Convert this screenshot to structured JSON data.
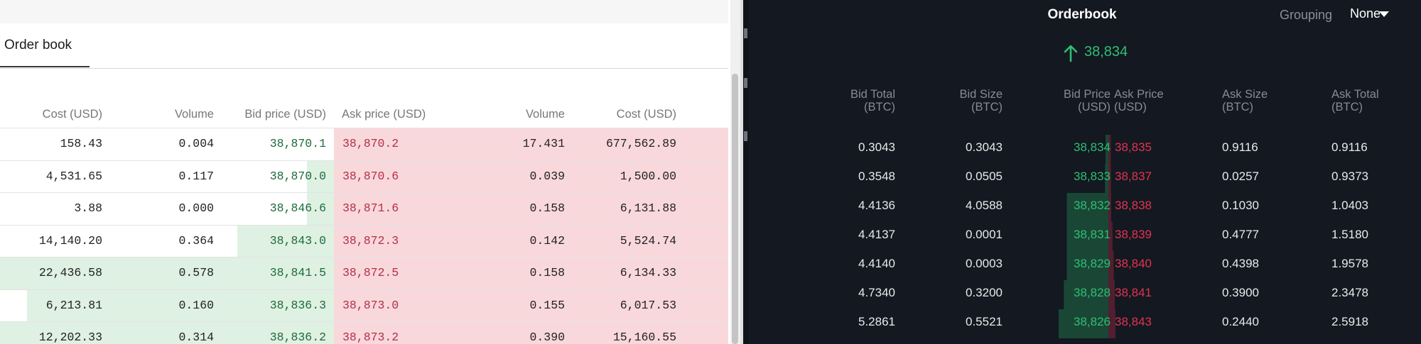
{
  "left": {
    "tab_label": "Order book",
    "headers": [
      "Cost (USD)",
      "Volume",
      "Bid price (USD)",
      "Ask price (USD)",
      "Volume",
      "Cost (USD)"
    ],
    "rows": [
      {
        "bid_cost": "158.43",
        "bid_vol": "0.004",
        "bid_price": "38,870.1",
        "ask_price": "38,870.2",
        "ask_vol": "17.431",
        "ask_cost": "677,562.89",
        "bid_depth": 0.0
      },
      {
        "bid_cost": "4,531.65",
        "bid_vol": "0.117",
        "bid_price": "38,870.0",
        "ask_price": "38,870.6",
        "ask_vol": "0.039",
        "ask_cost": "1,500.00",
        "bid_depth": 0.08
      },
      {
        "bid_cost": "3.88",
        "bid_vol": "0.000",
        "bid_price": "38,846.6",
        "ask_price": "38,871.6",
        "ask_vol": "0.158",
        "ask_cost": "6,131.88",
        "bid_depth": 0.08
      },
      {
        "bid_cost": "14,140.20",
        "bid_vol": "0.364",
        "bid_price": "38,843.0",
        "ask_price": "38,872.3",
        "ask_vol": "0.142",
        "ask_cost": "5,524.74",
        "bid_depth": 0.29
      },
      {
        "bid_cost": "22,436.58",
        "bid_vol": "0.578",
        "bid_price": "38,841.5",
        "ask_price": "38,872.5",
        "ask_vol": "0.158",
        "ask_cost": "6,134.33",
        "bid_depth": 1.0
      },
      {
        "bid_cost": "6,213.81",
        "bid_vol": "0.160",
        "bid_price": "38,836.3",
        "ask_price": "38,873.0",
        "ask_vol": "0.155",
        "ask_cost": "6,017.53",
        "bid_depth": 0.92
      },
      {
        "bid_cost": "12,202.33",
        "bid_vol": "0.314",
        "bid_price": "38,836.2",
        "ask_price": "38,873.2",
        "ask_vol": "0.390",
        "ask_cost": "15,160.55",
        "bid_depth": 1.0
      }
    ]
  },
  "right": {
    "title": "Orderbook",
    "grouping_label": "Grouping",
    "grouping_value": "None",
    "spread_value": "38,834",
    "headers": [
      {
        "line1": "Bid Total",
        "line2": "(BTC)"
      },
      {
        "line1": "Bid Size",
        "line2": "(BTC)"
      },
      {
        "line1": "Bid Price",
        "line2": "(USD)"
      },
      {
        "line1": "Ask Price",
        "line2": "(USD)"
      },
      {
        "line1": "Ask Size",
        "line2": "(BTC)"
      },
      {
        "line1": "Ask Total",
        "line2": "(BTC)"
      }
    ],
    "rows": [
      {
        "bid_total": "0.3043",
        "bid_size": "0.3043",
        "bid_price": "38,834",
        "ask_price": "38,835",
        "ask_size": "0.9116",
        "ask_total": "0.9116"
      },
      {
        "bid_total": "0.3548",
        "bid_size": "0.0505",
        "bid_price": "38,833",
        "ask_price": "38,837",
        "ask_size": "0.0257",
        "ask_total": "0.9373"
      },
      {
        "bid_total": "4.4136",
        "bid_size": "4.0588",
        "bid_price": "38,832",
        "ask_price": "38,838",
        "ask_size": "0.1030",
        "ask_total": "1.0403"
      },
      {
        "bid_total": "4.4137",
        "bid_size": "0.0001",
        "bid_price": "38,831",
        "ask_price": "38,839",
        "ask_size": "0.4777",
        "ask_total": "1.5180"
      },
      {
        "bid_total": "4.4140",
        "bid_size": "0.0003",
        "bid_price": "38,829",
        "ask_price": "38,840",
        "ask_size": "0.4398",
        "ask_total": "1.9578"
      },
      {
        "bid_total": "4.7340",
        "bid_size": "0.3200",
        "bid_price": "38,828",
        "ask_price": "38,841",
        "ask_size": "0.3900",
        "ask_total": "2.3478"
      },
      {
        "bid_total": "5.2861",
        "bid_size": "0.5521",
        "bid_price": "38,826",
        "ask_price": "38,843",
        "ask_size": "0.2440",
        "ask_total": "2.5918"
      }
    ]
  },
  "colors": {
    "bid": "#2fbf71",
    "ask": "#e1334f",
    "bid_bg": "#dff1e2",
    "ask_bg": "#f9d8dc"
  }
}
